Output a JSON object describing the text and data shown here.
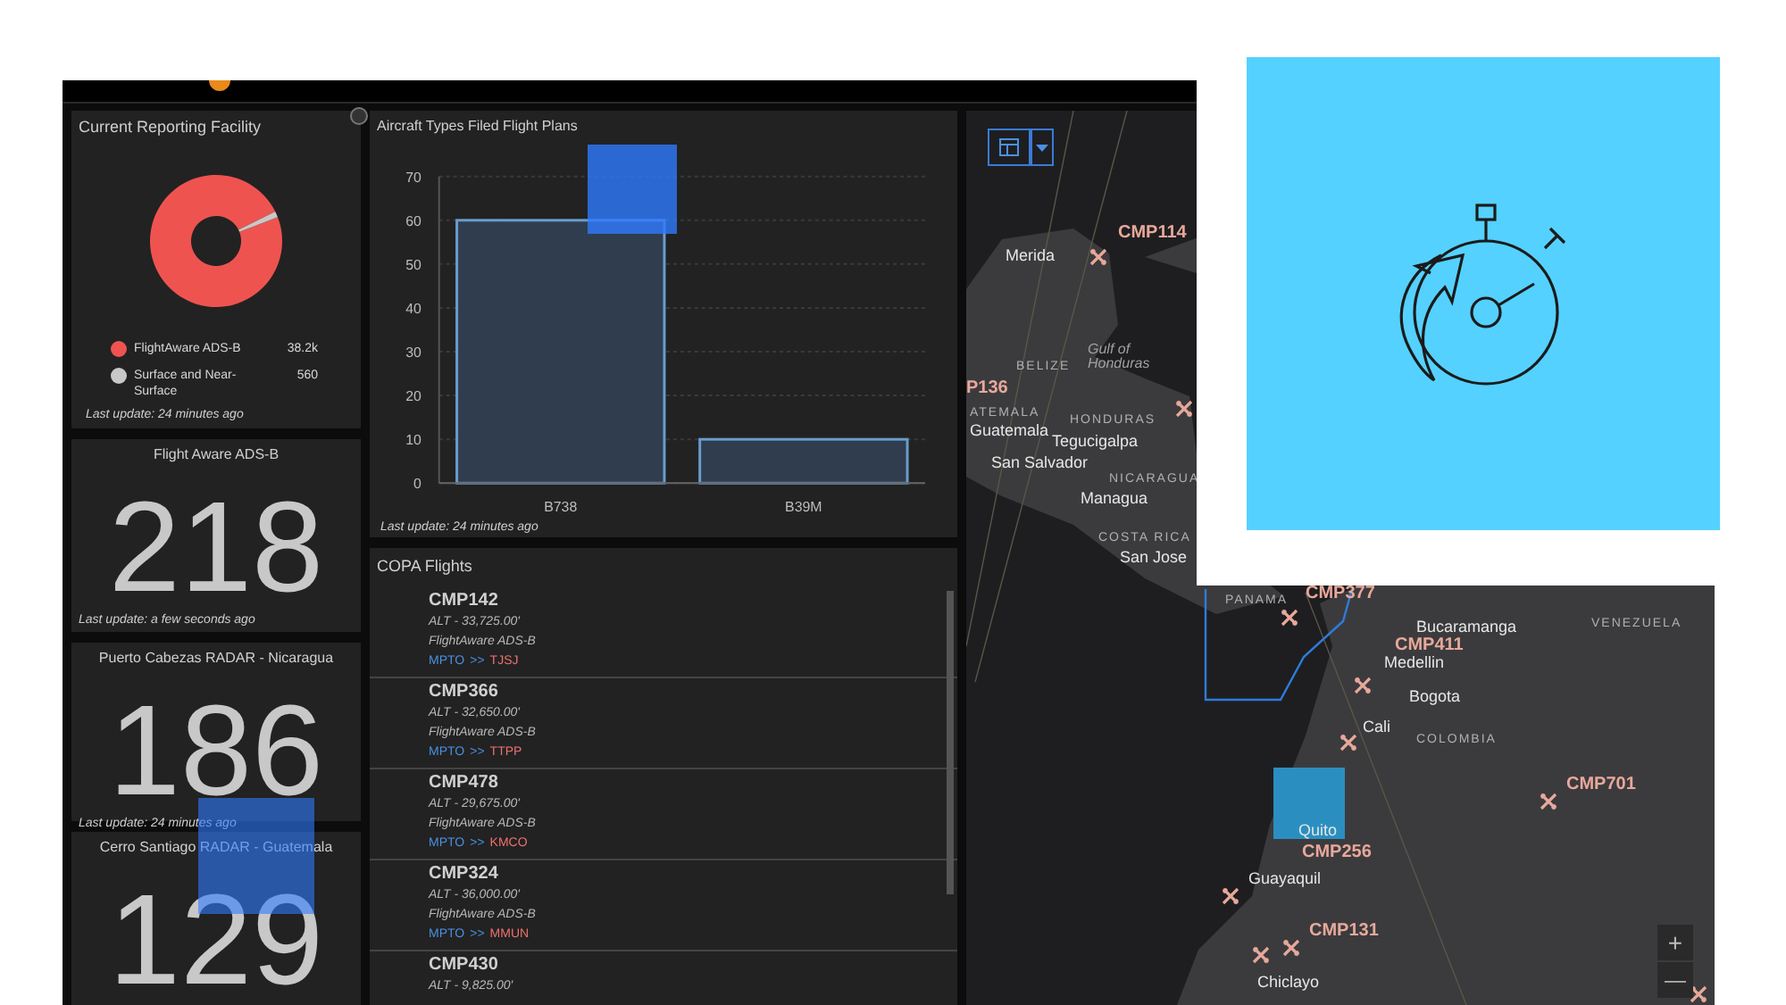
{
  "reporting_facility": {
    "title": "Current Reporting Facility",
    "legend": [
      {
        "label": "FlightAware ADS-B",
        "value": "38.2k",
        "color": "#ef5350"
      },
      {
        "label": "Surface and Near-Surface",
        "value": "560",
        "color": "#c8c8c8"
      }
    ],
    "chart_data": {
      "type": "donut",
      "values": [
        98.55,
        1.45
      ]
    },
    "footer": "Last update: 24 minutes ago"
  },
  "counters": [
    {
      "title": "Flight Aware ADS-B",
      "value": "218",
      "footer": "Last update: a few seconds ago"
    },
    {
      "title": "Puerto Cabezas RADAR - Nicaragua",
      "value": "186",
      "footer": "Last update: 24 minutes ago"
    },
    {
      "title": "Cerro Santiago RADAR - Guatemala",
      "value": "129"
    }
  ],
  "aircraft_chart": {
    "title": "Aircraft Types Filed Flight Plans",
    "chart_data": {
      "type": "bar",
      "categories": [
        "B738",
        "B39M"
      ],
      "values": [
        60,
        10
      ],
      "grid": true,
      "ylim": [
        0,
        70
      ],
      "yticks": [
        0,
        10,
        20,
        30,
        40,
        50,
        60,
        70
      ]
    },
    "footer": "Last update: 24 minutes ago"
  },
  "flights": {
    "title": "COPA Flights",
    "items": [
      {
        "callsign": "CMP142",
        "altitude": "ALT - 33,725.00'",
        "source": "FlightAware ADS-B",
        "origin": "MPTO",
        "arrow": ">>",
        "destination": "TJSJ"
      },
      {
        "callsign": "CMP366",
        "altitude": "ALT - 32,650.00'",
        "source": "FlightAware ADS-B",
        "origin": "MPTO",
        "arrow": ">>",
        "destination": "TTPP"
      },
      {
        "callsign": "CMP478",
        "altitude": "ALT - 29,675.00'",
        "source": "FlightAware ADS-B",
        "origin": "MPTO",
        "arrow": ">>",
        "destination": "KMCO"
      },
      {
        "callsign": "CMP324",
        "altitude": "ALT - 36,000.00'",
        "source": "FlightAware ADS-B",
        "origin": "MPTO",
        "arrow": ">>",
        "destination": "MMUN"
      },
      {
        "callsign": "CMP430",
        "altitude": "ALT - 9,825.00'"
      }
    ]
  },
  "map": {
    "zoom_in": "+",
    "zoom_out": "—",
    "labels": [
      {
        "text": "CMP114",
        "kind": "flight"
      },
      {
        "text": "Merida",
        "kind": "city"
      },
      {
        "text": "BELIZE",
        "kind": "country"
      },
      {
        "text": "Gulf of Honduras",
        "kind": "water"
      },
      {
        "text": "P136",
        "kind": "flight"
      },
      {
        "text": "ATEMALA",
        "kind": "country"
      },
      {
        "text": "Guatemala",
        "kind": "city"
      },
      {
        "text": "HONDURAS",
        "kind": "country"
      },
      {
        "text": "Tegucigalpa",
        "kind": "city"
      },
      {
        "text": "San Salvador",
        "kind": "city"
      },
      {
        "text": "NICARAGUA",
        "kind": "country"
      },
      {
        "text": "Managua",
        "kind": "city"
      },
      {
        "text": "COSTA RICA",
        "kind": "country"
      },
      {
        "text": "San Jose",
        "kind": "city"
      },
      {
        "text": "PANAMA",
        "kind": "country"
      },
      {
        "text": "CMP377",
        "kind": "flight"
      },
      {
        "text": "Bucaramanga",
        "kind": "city"
      },
      {
        "text": "VENEZUELA",
        "kind": "country"
      },
      {
        "text": "CMP411",
        "kind": "flight"
      },
      {
        "text": "Medellin",
        "kind": "city"
      },
      {
        "text": "Bogota",
        "kind": "city"
      },
      {
        "text": "Cali",
        "kind": "city"
      },
      {
        "text": "COLOMBIA",
        "kind": "country"
      },
      {
        "text": "CMP701",
        "kind": "flight"
      },
      {
        "text": "Quito",
        "kind": "city"
      },
      {
        "text": "CMP256",
        "kind": "flight"
      },
      {
        "text": "Guayaquil",
        "kind": "city"
      },
      {
        "text": "CMP131",
        "kind": "flight"
      },
      {
        "text": "Chiclayo",
        "kind": "city"
      }
    ]
  }
}
